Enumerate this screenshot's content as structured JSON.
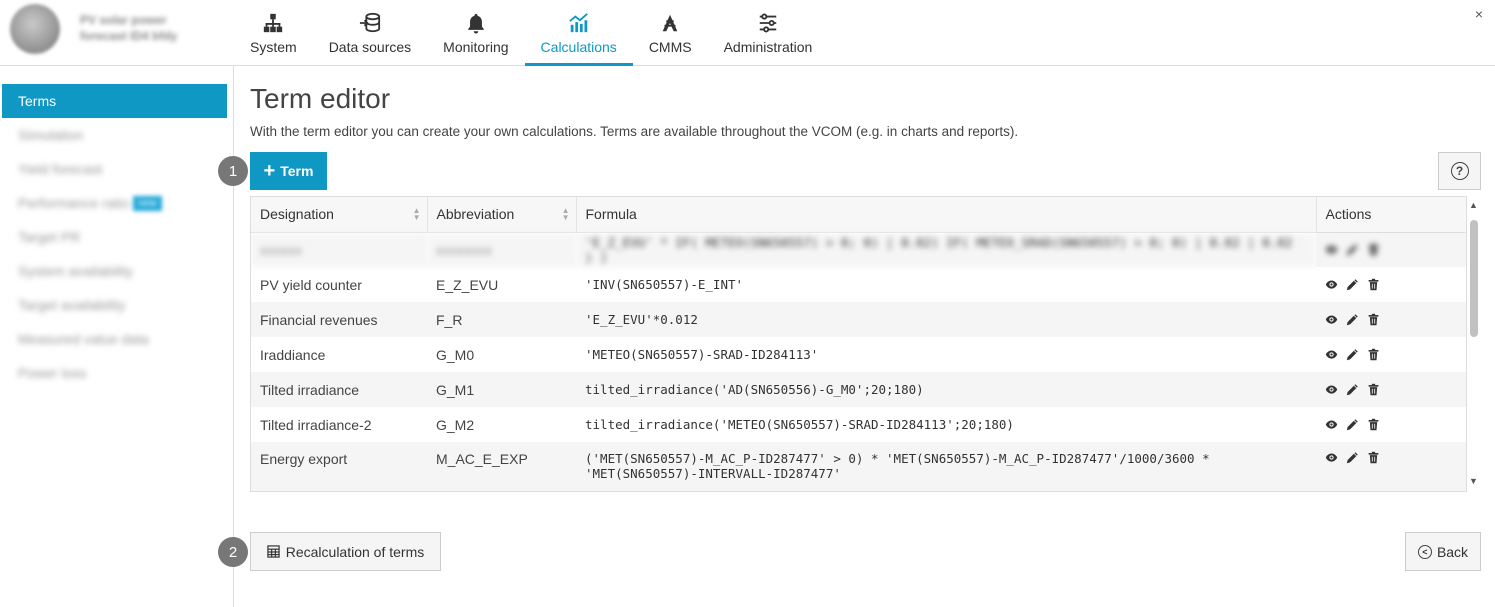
{
  "header": {
    "brand_line1": "PV solar power",
    "brand_line2": "forecast ID4 bfdy",
    "nav": [
      {
        "label": "System",
        "icon": "sitemap-icon"
      },
      {
        "label": "Data sources",
        "icon": "database-import-icon"
      },
      {
        "label": "Monitoring",
        "icon": "bell-icon"
      },
      {
        "label": "Calculations",
        "icon": "chart-bar-icon",
        "active": true
      },
      {
        "label": "CMMS",
        "icon": "tools-icon"
      },
      {
        "label": "Administration",
        "icon": "sliders-icon"
      }
    ],
    "close_glyph": "×"
  },
  "sidebar": {
    "items": [
      {
        "label": "Terms",
        "active": true
      },
      {
        "label": "Simulation",
        "blurred": true
      },
      {
        "label": "Yield forecast",
        "blurred": true
      },
      {
        "label": "Performance ratio",
        "blurred": true,
        "badge": "new"
      },
      {
        "label": "Target PR",
        "blurred": true
      },
      {
        "label": "System availability",
        "blurred": true
      },
      {
        "label": "Target availability",
        "blurred": true
      },
      {
        "label": "Measured value data",
        "blurred": true
      },
      {
        "label": "Power loss",
        "blurred": true
      }
    ]
  },
  "main": {
    "title": "Term editor",
    "description": "With the term editor you can create your own calculations. Terms are available throughout the VCOM (e.g. in charts and reports).",
    "markers": [
      "1",
      "2"
    ],
    "term_button_label": "Term",
    "help_glyph": "?",
    "table": {
      "headers": [
        "Designation",
        "Abbreviation",
        "Formula",
        "Actions"
      ],
      "rows": [
        {
          "designation": "xxxxxx",
          "abbreviation": "xxxxxxxx",
          "formula": "'E_Z_EVU' * IF( METEO(SN650557) > 0; 0) | 0.02) IF( METEO_SRAD(SN650557) > 0; 0) | 0.02 | 0.02 ) )",
          "blurred": true
        },
        {
          "designation": "PV yield counter",
          "abbreviation": "E_Z_EVU",
          "formula": "'INV(SN650557)-E_INT'"
        },
        {
          "designation": "Financial revenues",
          "abbreviation": "F_R",
          "formula": "'E_Z_EVU'*0.012"
        },
        {
          "designation": "Iraddiance",
          "abbreviation": "G_M0",
          "formula": "'METEO(SN650557)-SRAD-ID284113'"
        },
        {
          "designation": "Tilted irradiance",
          "abbreviation": "G_M1",
          "formula": "tilted_irradiance('AD(SN650556)-G_M0';20;180)"
        },
        {
          "designation": "Tilted irradiance-2",
          "abbreviation": "G_M2",
          "formula": "tilted_irradiance('METEO(SN650557)-SRAD-ID284113';20;180)"
        },
        {
          "designation": "Energy export",
          "abbreviation": "M_AC_E_EXP",
          "formula": "('MET(SN650557)-M_AC_P-ID287477' > 0) * 'MET(SN650557)-M_AC_P-ID287477'/1000/3600 *",
          "formula_line2": "'MET(SN650557)-INTERVALL-ID287477'"
        }
      ]
    },
    "recalc_button_label": "Recalculation of terms",
    "back_button_label": "Back"
  },
  "colors": {
    "accent": "#0f98c4",
    "marker": "#777777"
  }
}
